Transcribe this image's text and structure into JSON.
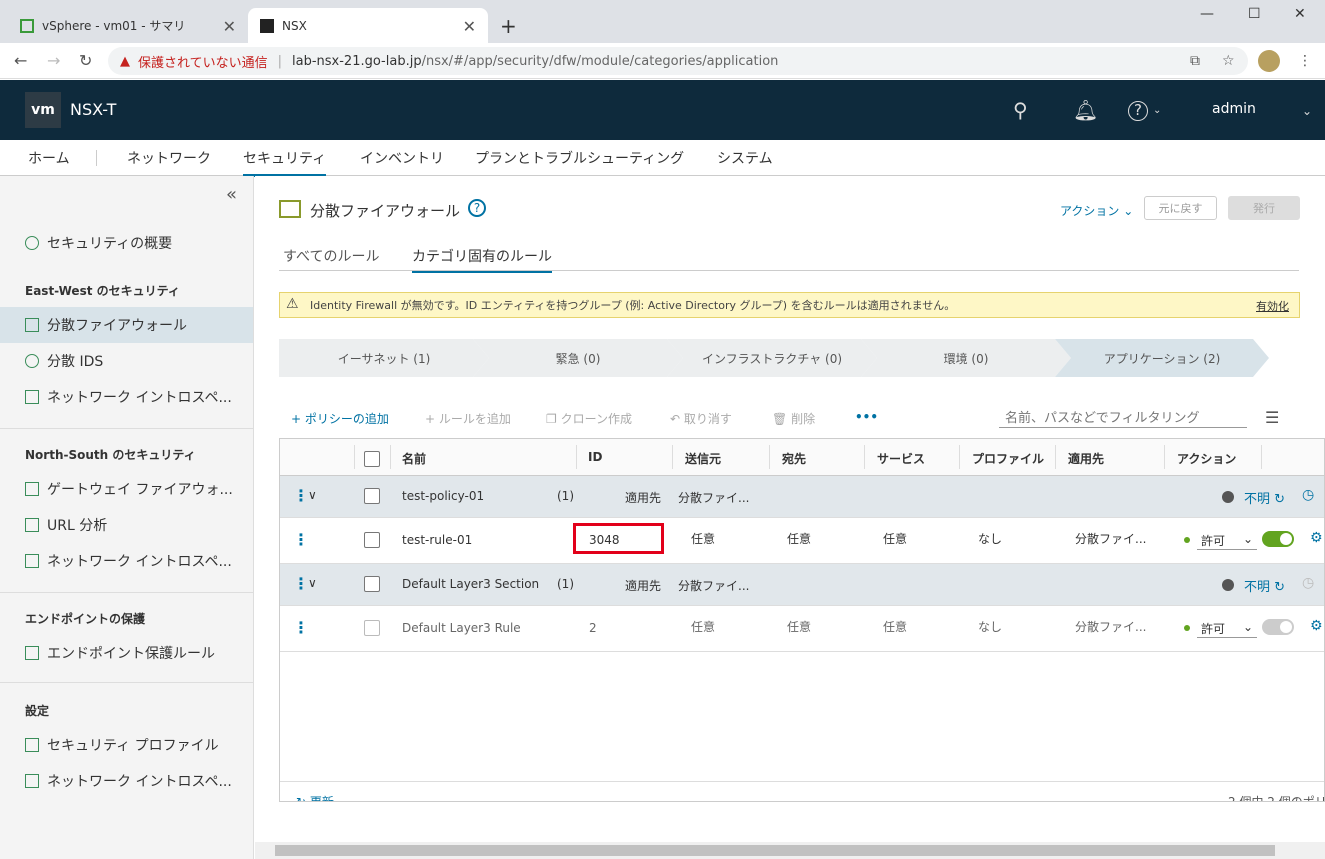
{
  "browser": {
    "tabs": [
      {
        "title": "vSphere - vm01 - サマリ",
        "active": false
      },
      {
        "title": "NSX",
        "active": true
      }
    ],
    "security_warning": "保護されていない通信",
    "url_host": "lab-nsx-21.go-lab.jp",
    "url_path": "/nsx/#/app/security/dfw/module/categories/application"
  },
  "header": {
    "logo": "vm",
    "product": "NSX-T",
    "user": "admin",
    "help_label": "?"
  },
  "topnav": [
    "ホーム",
    "ネットワーク",
    "セキュリティ",
    "インベントリ",
    "プランとトラブルシューティング",
    "システム"
  ],
  "sidebar": {
    "overview": "セキュリティの概要",
    "ew_head": "East-West のセキュリティ",
    "ew_items": [
      "分散ファイアウォール",
      "分散 IDS",
      "ネットワーク イントロスペ..."
    ],
    "ns_head": "North-South のセキュリティ",
    "ns_items": [
      "ゲートウェイ ファイアウォ...",
      "URL 分析",
      "ネットワーク イントロスペ..."
    ],
    "ep_head": "エンドポイントの保護",
    "ep_items": [
      "エンドポイント保護ルール"
    ],
    "settings_head": "設定",
    "settings_items": [
      "セキュリティ プロファイル",
      "ネットワーク イントロスペ..."
    ]
  },
  "page": {
    "title": "分散ファイアウォール",
    "action": "アクション",
    "revert": "元に戻す",
    "publish": "発行",
    "subtabs": [
      "すべてのルール",
      "カテゴリ固有のルール"
    ],
    "banner": "Identity Firewall が無効です。ID エンティティを持つグループ (例: Active Directory グループ) を含むルールは適用されません。",
    "banner_link": "有効化",
    "categories": [
      "イーサネット (1)",
      "緊急 (0)",
      "インフラストラクチャ (0)",
      "環境 (0)",
      "アプリケーション (2)"
    ],
    "toolbar": {
      "add_policy": "+ ポリシーの追加",
      "add_rule": "+ ルールを追加",
      "clone": "クローン作成",
      "undo": "取り消す",
      "delete": "削除",
      "more": "•••",
      "filter_placeholder": "名前、パスなどでフィルタリング"
    },
    "columns": [
      "名前",
      "ID",
      "送信元",
      "宛先",
      "サービス",
      "プロファイル",
      "適用先",
      "アクション"
    ],
    "policies": [
      {
        "name": "test-policy-01",
        "count": "(1)",
        "applied_label": "適用先",
        "applied": "分散ファイ...",
        "status": "不明",
        "rule": {
          "name": "test-rule-01",
          "id": "3048",
          "source": "任意",
          "dest": "任意",
          "service": "任意",
          "profile": "なし",
          "applied": "分散ファイ...",
          "action": "許可",
          "enabled": true
        }
      },
      {
        "name": "Default Layer3 Section",
        "count": "(1)",
        "applied_label": "適用先",
        "applied": "分散ファイ...",
        "status": "不明",
        "rule": {
          "name": "Default Layer3 Rule",
          "id": "2",
          "source": "任意",
          "dest": "任意",
          "service": "任意",
          "profile": "なし",
          "applied": "分散ファイ...",
          "action": "許可",
          "enabled": false
        }
      }
    ],
    "refresh": "更新",
    "count": "2 個中 2 個のポリ"
  },
  "colors": {
    "accent": "#0072a3",
    "header_bg": "#0e2a3c",
    "highlight": "#e2001a",
    "allow_green": "#62a420"
  }
}
